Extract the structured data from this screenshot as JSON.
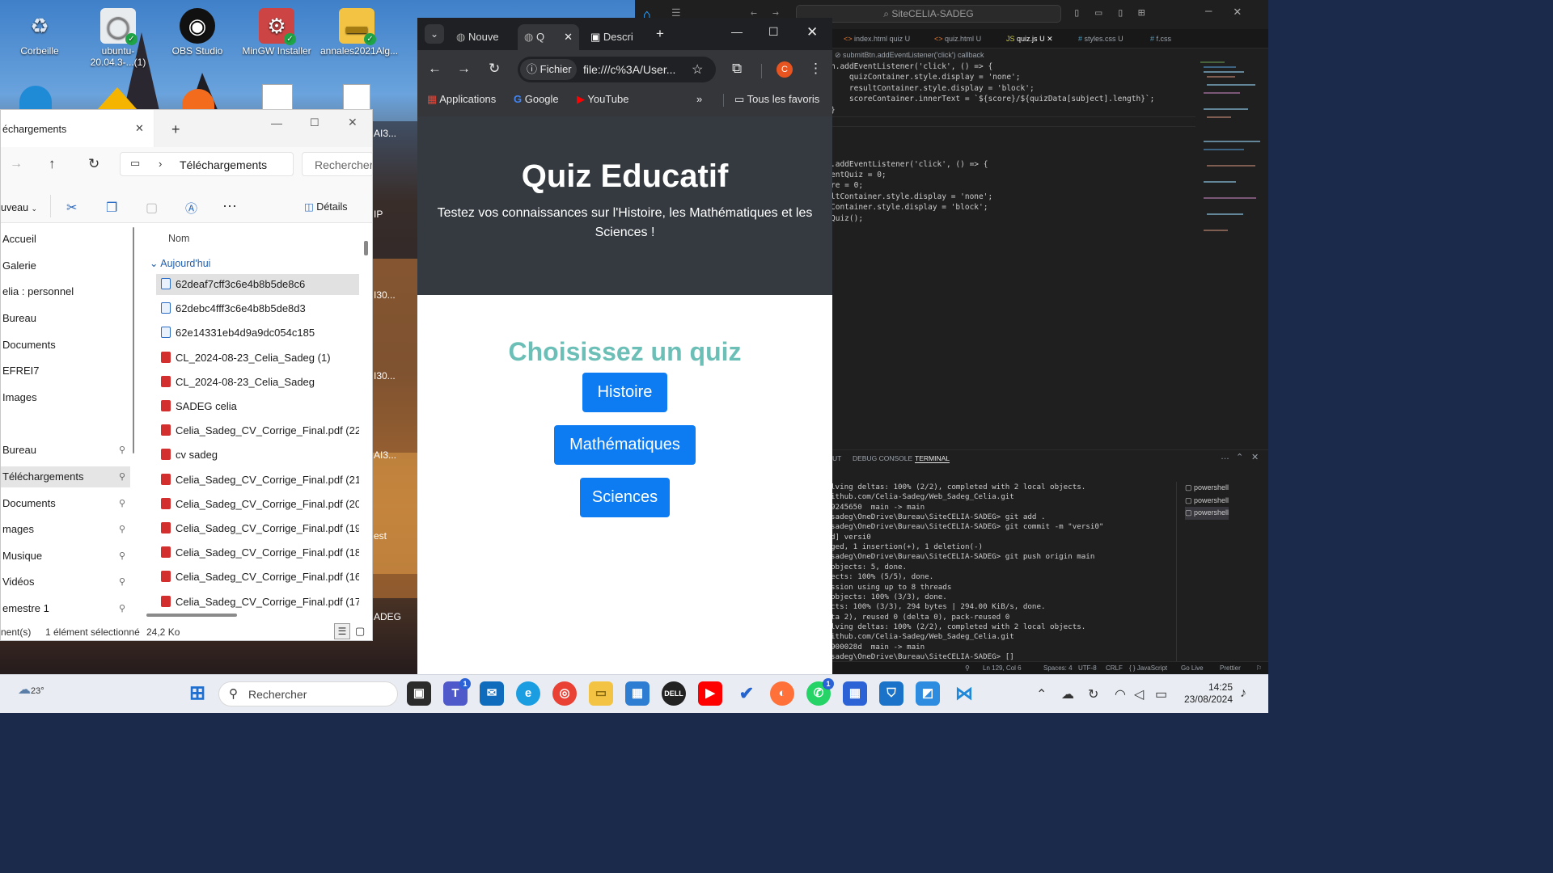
{
  "desktop": {
    "icons": [
      {
        "label": "Corbeille",
        "glyph": "♻"
      },
      {
        "label": "ubuntu-20.04.3-...(1)",
        "glyph": "◯"
      },
      {
        "label": "OBS Studio",
        "glyph": "◉"
      },
      {
        "label": "MinGW Installer",
        "glyph": "⚙"
      },
      {
        "label": "annales2021Alg...",
        "glyph": "▬"
      }
    ],
    "side_labels": [
      "AI3...",
      "IP",
      "I30...",
      "I30...",
      "AI3...",
      "est",
      "ADEG"
    ]
  },
  "explorer": {
    "title": "échargements",
    "breadcrumb": "Téléchargements",
    "search_placeholder": "Rechercher",
    "new_label": "uveau",
    "details_label": "Détails",
    "column_name": "Nom",
    "group_label": "Aujourd'hui",
    "nav": [
      {
        "label": "Accueil",
        "pinned": false
      },
      {
        "label": "Galerie",
        "pinned": false
      },
      {
        "label": "elia : personnel",
        "pinned": false
      },
      {
        "label": "Bureau",
        "pinned": false
      },
      {
        "label": "Documents",
        "pinned": false
      },
      {
        "label": "EFREI7",
        "pinned": false
      },
      {
        "label": "Images",
        "pinned": false
      },
      {
        "label": "Bureau",
        "pinned": true
      },
      {
        "label": "Téléchargements",
        "pinned": true
      },
      {
        "label": "Documents",
        "pinned": true
      },
      {
        "label": "mages",
        "pinned": true
      },
      {
        "label": "Musique",
        "pinned": true
      },
      {
        "label": "Vidéos",
        "pinned": true
      },
      {
        "label": "emestre 1",
        "pinned": true
      }
    ],
    "files": [
      {
        "name": "62deaf7cff3c6e4b8b5de8c6",
        "type": "doc"
      },
      {
        "name": "62debc4fff3c6e4b8b5de8d3",
        "type": "doc"
      },
      {
        "name": "62e14331eb4d9a9dc054c185",
        "type": "doc"
      },
      {
        "name": "CL_2024-08-23_Celia_Sadeg (1)",
        "type": "pdf"
      },
      {
        "name": "CL_2024-08-23_Celia_Sadeg",
        "type": "pdf"
      },
      {
        "name": "SADEG celia",
        "type": "pdf"
      },
      {
        "name": "Celia_Sadeg_CV_Corrige_Final.pdf (22)",
        "type": "pdf"
      },
      {
        "name": "cv sadeg",
        "type": "pdf"
      },
      {
        "name": "Celia_Sadeg_CV_Corrige_Final.pdf (21)",
        "type": "pdf"
      },
      {
        "name": "Celia_Sadeg_CV_Corrige_Final.pdf (20)",
        "type": "pdf"
      },
      {
        "name": "Celia_Sadeg_CV_Corrige_Final.pdf (19)",
        "type": "pdf"
      },
      {
        "name": "Celia_Sadeg_CV_Corrige_Final.pdf (18)",
        "type": "pdf"
      },
      {
        "name": "Celia_Sadeg_CV_Corrige_Final.pdf (16)",
        "type": "pdf"
      },
      {
        "name": "Celia_Sadeg_CV_Corrige_Final.pdf (17)",
        "type": "pdf"
      }
    ],
    "status_count": "nent(s)",
    "status_selected": "1 élément sélectionné",
    "status_size": "24,2 Ko"
  },
  "chrome": {
    "tabs": [
      "Nouve",
      "Q",
      "Descri"
    ],
    "scheme_label": "Fichier",
    "url": "file:///c%3A/User...",
    "profile_initial": "C",
    "bookmarks": [
      "Applications",
      "Google",
      "YouTube"
    ],
    "all_bookmarks": "Tous les favoris"
  },
  "quiz": {
    "title": "Quiz Educatif",
    "subtitle": "Testez vos connaissances sur l'Histoire, les Mathématiques et les Sciences !",
    "choose": "Choisissez un quiz",
    "buttons": [
      "Histoire",
      "Mathématiques",
      "Sciences"
    ]
  },
  "vscode": {
    "search": "SiteCELIA-SADEG",
    "tabs": [
      {
        "name": "index.html",
        "suffix": "quiz U",
        "icon": "<>"
      },
      {
        "name": "quiz.html",
        "suffix": "U",
        "icon": "<>"
      },
      {
        "name": "quiz.js",
        "suffix": "U",
        "icon": "JS"
      },
      {
        "name": "styles.css",
        "suffix": "U",
        "icon": "#"
      },
      {
        "name": "f.css",
        "suffix": "",
        "icon": "#"
      }
    ],
    "breadcrumb": "submitBtn.addEventListener('click') callback",
    "code_lines": [
      "n.addEventListener('click', () => {",
      "    quizContainer.style.display = 'none';",
      "    resultContainer.style.display = 'block';",
      "    scoreContainer.innerText = `${score}/${quizData[subject].length}`;",
      "}",
      "",
      "",
      "",
      "",
      ".addEventListener('click', () => {",
      "entQuiz = 0;",
      "re = 0;",
      "ltContainer.style.display = 'none';",
      "Container.style.display = 'block';",
      "Quiz();"
    ],
    "panel_tabs": [
      "UT",
      "DEBUG CONSOLE",
      "TERMINAL"
    ],
    "terminal_lines": [
      "lving deltas: 100% (2/2), completed with 2 local objects.",
      "ithub.com/Celia-Sadeg/Web_Sadeg_Celia.git",
      "9245650  main -> main",
      "sadeg\\OneDrive\\Bureau\\SiteCELIA-SADEG> git add .",
      "sadeg\\OneDrive\\Bureau\\SiteCELIA-SADEG> git commit -m \"versi0\"",
      "d] versi0",
      "ged, 1 insertion(+), 1 deletion(-)",
      "sadeg\\OneDrive\\Bureau\\SiteCELIA-SADEG> git push origin main",
      "objects: 5, done.",
      "ects: 100% (5/5), done.",
      "ssion using up to 8 threads",
      "objects: 100% (3/3), done.",
      "cts: 100% (3/3), 294 bytes | 294.00 KiB/s, done.",
      "ta 2), reused 0 (delta 0), pack-reused 0",
      "lving deltas: 100% (2/2), completed with 2 local objects.",
      "ithub.com/Celia-Sadeg/Web_Sadeg_Celia.git",
      "900028d  main -> main",
      "sadeg\\OneDrive\\Bureau\\SiteCELIA-SADEG> []"
    ],
    "shells": [
      "powershell",
      "powershell",
      "powershell"
    ],
    "status": [
      "Ln 129, Col 6",
      "Spaces: 4",
      "UTF-8",
      "CRLF",
      "{ } JavaScript",
      "Go Live",
      "Prettier"
    ]
  },
  "taskbar": {
    "weather": "23°",
    "search_placeholder": "Rechercher",
    "time": "14:25",
    "date": "23/08/2024",
    "badges": {
      "teams": "1",
      "whatsapp": "1"
    }
  },
  "colors": {
    "accent_blue": "#0d7cf2",
    "quiz_header": "#343a40",
    "quiz_choose": "#6cbfb7"
  }
}
